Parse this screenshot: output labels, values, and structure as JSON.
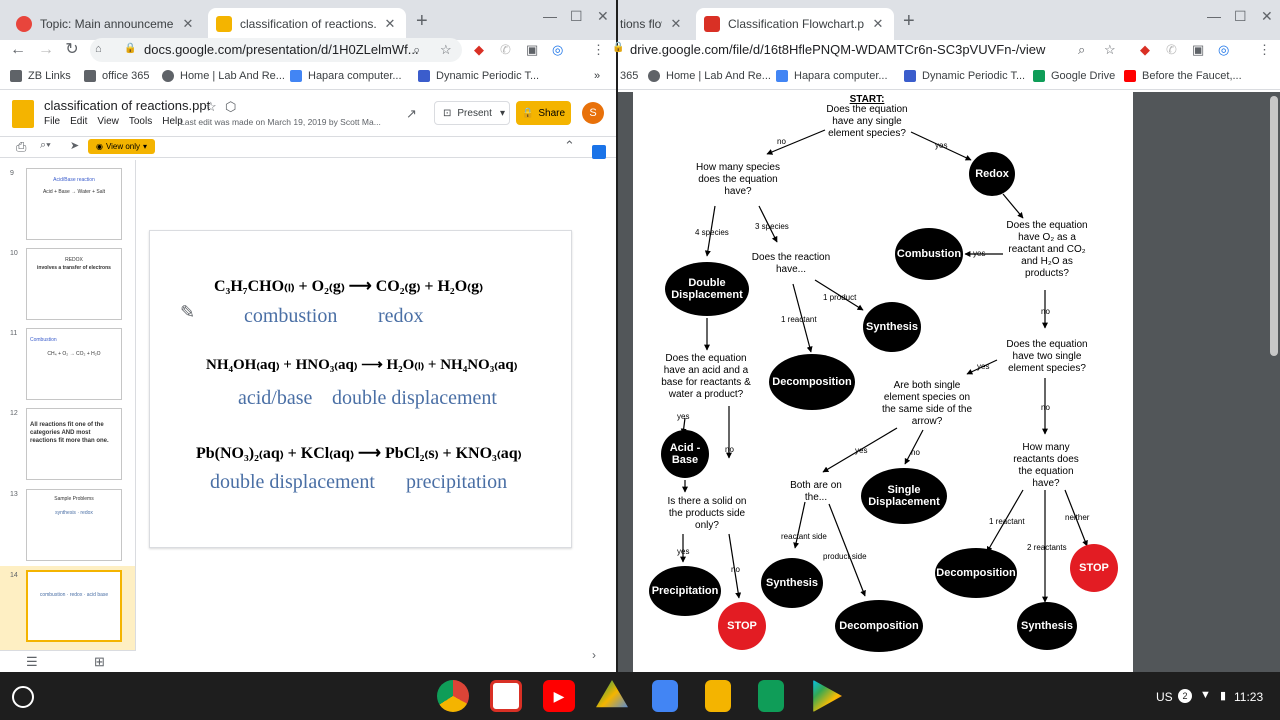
{
  "left_window": {
    "tabs": [
      {
        "title": "Topic: Main announcement and a",
        "active": false,
        "fav": "#e8453c"
      },
      {
        "title": "classification of reactions.ppt - G",
        "active": true,
        "fav": "#f4b400"
      }
    ],
    "url": "docs.google.com/presentation/d/1H0ZLelmWf...",
    "bookmarks": [
      "ZB Links",
      "office 365",
      "Home | Lab And Re...",
      "Hapara computer...",
      "Dynamic Periodic T..."
    ],
    "bookmarks_more": "»"
  },
  "right_window": {
    "tabs": [
      {
        "title": "tions flow",
        "active": false,
        "fav": "#888"
      },
      {
        "title": "Classification Flowchart.pdf - Go",
        "active": true,
        "fav": "#d93025"
      }
    ],
    "url": "drive.google.com/file/d/16t8HflePNQM-WDAMTCr6n-SC3pVUVFn-/view",
    "bookmarks": [
      "365",
      "Home | Lab And Re...",
      "Hapara computer...",
      "Dynamic Periodic T...",
      "Google Drive",
      "Before the Faucet,..."
    ]
  },
  "slides": {
    "doc_title": "classification of reactions.ppt",
    "menu": [
      "File",
      "Edit",
      "View",
      "Tools",
      "Help"
    ],
    "last_edit": "Last edit was made on March 19, 2019 by Scott Ma...",
    "present_label": "Present",
    "share_label": "Share",
    "avatar": "S",
    "view_only": "View only",
    "thumbs": [
      {
        "num": "9",
        "title": "Acid/Base reaction",
        "body": "Acid + Base → Water + Salt"
      },
      {
        "num": "10",
        "title": "REDOX",
        "body": "involves a transfer of electrons"
      },
      {
        "num": "11",
        "title": "Combustion",
        "body": "CH₄ + O₂ → CO₂ + H₂O"
      },
      {
        "num": "12",
        "title": "All reactions fit one of the categories AND most reactions fit more than one.",
        "body": ""
      },
      {
        "num": "13",
        "title": "Sample Problems",
        "body": "synthesis · redox"
      },
      {
        "num": "14",
        "title": "",
        "body": "combustion · redox · acid base"
      }
    ],
    "equations": [
      {
        "eq": "C₃H₇CHO₍ₗ₎ + O₂₍g₎ ⟶ CO₂₍g₎ + H₂O₍g₎",
        "labels": [
          "combustion",
          "redox"
        ]
      },
      {
        "eq": "NH₄OH₍aq₎ + HNO₃₍aq₎ ⟶ H₂O₍ₗ₎ + NH₄NO₃₍aq₎",
        "labels": [
          "acid/base",
          "double displacement"
        ]
      },
      {
        "eq": "Pb(NO₃)₂₍aq₎ + KCl₍aq₎ ⟶ PbCl₂₍s₎ + KNO₃₍aq₎",
        "labels": [
          "double displacement",
          "precipitation"
        ]
      }
    ]
  },
  "flowchart": {
    "start_title": "START:",
    "start_q": "Does the equation have any single element species?",
    "no": "no",
    "yes": "yes",
    "q_how_many": "How many species does the equation have?",
    "four_species": "4 species",
    "three_species": "3 species",
    "double_disp": "Double Displacement",
    "q_reaction_have": "Does the reaction have...",
    "one_product": "1 product",
    "one_reactant": "1 reactant",
    "synthesis": "Synthesis",
    "decomposition": "Decomposition",
    "q_acid_base": "Does the equation have an acid and a base for reactants & water a product?",
    "acid_base": "Acid - Base",
    "q_solid": "Is there a solid on the products side only?",
    "precipitation": "Precipitation",
    "stop": "STOP",
    "redox": "Redox",
    "q_o2": "Does the equation have O₂ as a reactant and CO₂ and H₂O as products?",
    "combustion": "Combustion",
    "q_two_single": "Does the equation have two single element species?",
    "q_same_side": "Are both single element species on the same side of the arrow?",
    "single_disp": "Single Displacement",
    "both_on": "Both are on the...",
    "reactant_side": "reactant side",
    "product_side": "product side",
    "q_how_many_reactants": "How many reactants does the equation have?",
    "one_reactant_b": "1 reactant",
    "two_reactants": "2 reactants",
    "neither": "neither"
  },
  "shelf": {
    "locale": "US",
    "notif": "2",
    "time": "11:23"
  }
}
